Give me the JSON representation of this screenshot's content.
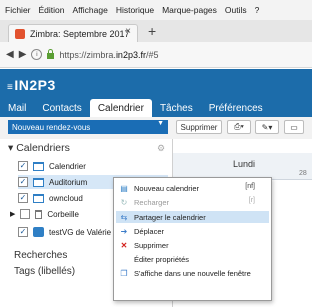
{
  "browser": {
    "menu": [
      "Fichier",
      "Édition",
      "Affichage",
      "Historique",
      "Marque-pages",
      "Outils",
      "?"
    ],
    "tab_title": "Zimbra: Septembre 2017",
    "url_prefix": "https://zimbra.",
    "url_domain": "in2p3.fr",
    "url_suffix": "/#5"
  },
  "app": {
    "logo": "IN2P3",
    "nav_tabs": [
      "Mail",
      "Contacts",
      "Calendrier",
      "Tâches",
      "Préférences"
    ],
    "active_tab": "Calendrier"
  },
  "toolbar": {
    "new_appointment": "Nouveau rendez-vous",
    "delete": "Supprimer"
  },
  "sidebar": {
    "heading": "Calendriers",
    "items": [
      {
        "label": "Calendrier",
        "checked": true
      },
      {
        "label": "Auditorium",
        "checked": true
      },
      {
        "label": "owncloud",
        "checked": true
      },
      {
        "label": "Corbeille",
        "checked": false
      },
      {
        "label": "testVG de Valérie Gi",
        "checked": true
      }
    ],
    "searches": "Recherches",
    "tags": "Tags (libellés)"
  },
  "calendar": {
    "day": "Lundi",
    "partial_number": "28"
  },
  "context_menu": {
    "items": [
      {
        "label": "Nouveau calendrier",
        "shortcut": "[nf]",
        "icon": "new-calendar-icon",
        "disabled": false
      },
      {
        "label": "Recharger",
        "shortcut": "[r]",
        "icon": "reload-icon",
        "disabled": true
      },
      {
        "label": "Partager le calendrier",
        "shortcut": "",
        "icon": "share-icon",
        "disabled": false,
        "highlight": true
      },
      {
        "label": "Déplacer",
        "shortcut": "",
        "icon": "move-icon",
        "disabled": false
      },
      {
        "label": "Supprimer",
        "shortcut": "",
        "icon": "delete-icon",
        "disabled": false
      },
      {
        "label": "Éditer propriétés",
        "shortcut": "",
        "icon": "",
        "disabled": false
      },
      {
        "label": "S'affiche dans une nouvelle fenêtre",
        "shortcut": "",
        "icon": "new-window-icon",
        "disabled": false
      }
    ]
  },
  "colors": {
    "brand_blue": "#1c6caa",
    "highlight": "#cfe3f5"
  }
}
